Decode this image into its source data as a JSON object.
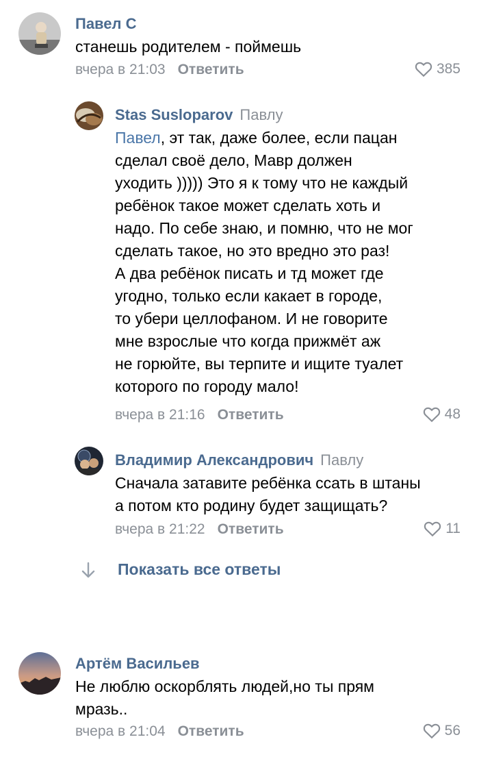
{
  "comments": [
    {
      "author": "Павел С",
      "text": "станешь родителем - поймешь",
      "time": "вчера в 21:03",
      "reply_label": "Ответить",
      "likes": "385"
    },
    {
      "author": "Stas Susloparov",
      "reply_to": "Павлу",
      "mention": "Павел",
      "text_lines": [
        ", эт так, даже более, если пацан",
        "сделал своё дело, Мавр должен",
        "уходить ))))) Это я к тому что не каждый",
        "ребёнок такое может сделать хоть и",
        "надо. По себе знаю, и помню, что не мог",
        "сделать такое, но это вредно это раз!",
        "А два ребёнок писать и тд может где",
        "угодно, только если какает в городе,",
        "то убери целлофаном. И не говорите",
        "мне взрослые что когда прижмёт аж",
        "не горюйте, вы терпите и ищите туалет",
        "которого по городу мало!"
      ],
      "time": "вчера в 21:16",
      "reply_label": "Ответить",
      "likes": "48"
    },
    {
      "author": "Владимир Александрович",
      "reply_to": "Павлу",
      "text_lines": [
        "Сначала затавите ребёнка ссать в штаны",
        "а потом кто родину будет защищать?"
      ],
      "time": "вчера в 21:22",
      "reply_label": "Ответить",
      "likes": "11"
    },
    {
      "author": "Артём Васильев",
      "text_lines": [
        "Не люблю оскорблять людей,но ты прям",
        "мразь.."
      ],
      "time": "вчера в 21:04",
      "reply_label": "Ответить",
      "likes": "56"
    }
  ],
  "show_all_replies": "Показать все ответы",
  "icons": {
    "like": "heart-outline-icon",
    "expand": "arrow-down-icon"
  },
  "colors": {
    "author": "#4a6a8f",
    "mention": "#4a76a8",
    "secondary": "#8a8f96"
  }
}
